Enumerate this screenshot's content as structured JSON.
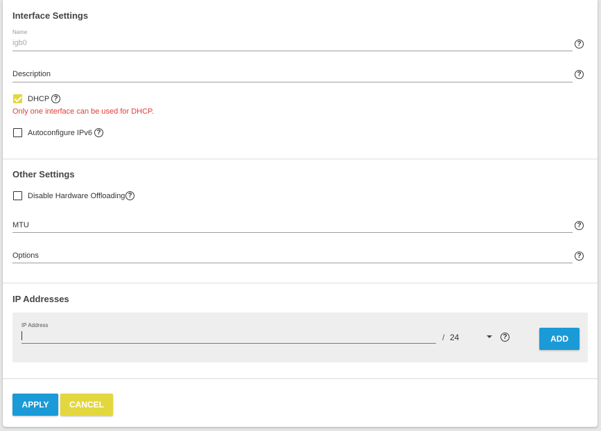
{
  "interface_settings": {
    "title": "Interface Settings",
    "name_label": "Name",
    "name_value": "igb0",
    "description_label": "Description",
    "dhcp_label": "DHCP",
    "dhcp_checked": true,
    "dhcp_error": "Only one interface can be used for DHCP.",
    "autoconfig_label": "Autoconfigure IPv6",
    "autoconfig_checked": false
  },
  "other_settings": {
    "title": "Other Settings",
    "disable_offload_label": "Disable Hardware Offloading",
    "disable_offload_checked": false,
    "mtu_label": "MTU",
    "options_label": "Options"
  },
  "ip_addresses": {
    "title": "IP Addresses",
    "ip_label": "IP Address",
    "ip_value": "",
    "slash": "/",
    "netmask": "24",
    "add_label": "ADD"
  },
  "actions": {
    "apply_label": "APPLY",
    "cancel_label": "CANCEL"
  },
  "colors": {
    "accent_blue": "#1a9ad6",
    "accent_yellow": "#e3d73f",
    "error_red": "#e53935"
  }
}
